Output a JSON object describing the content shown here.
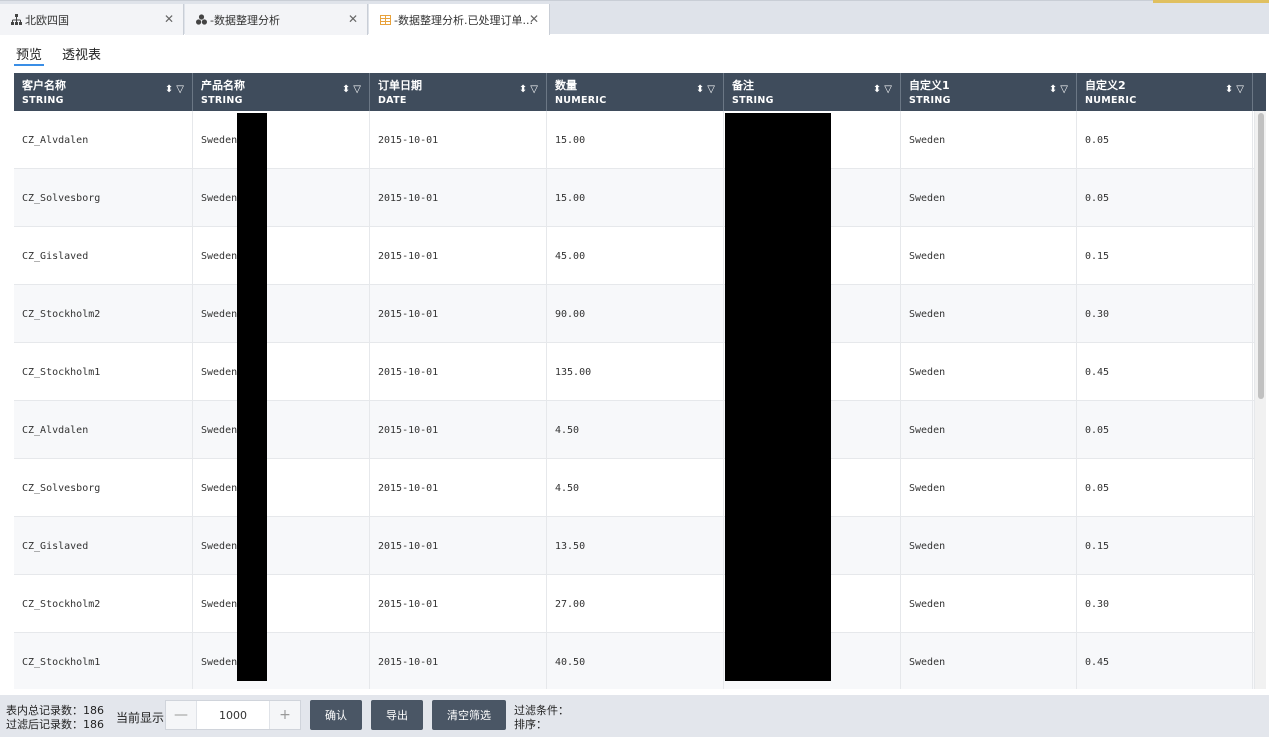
{
  "tabs": [
    {
      "icon": "hierarchy-icon",
      "label": "北欧四国"
    },
    {
      "icon": "cluster-icon",
      "label": "-数据整理分析"
    },
    {
      "icon": "table-icon",
      "label": "-数据整理分析.已处理订单..."
    }
  ],
  "subtabs": [
    {
      "label": "预览"
    },
    {
      "label": "透视表"
    }
  ],
  "columns": [
    {
      "name": "客户名称",
      "type": "STRING"
    },
    {
      "name": "产品名称",
      "type": "STRING"
    },
    {
      "name": "订单日期",
      "type": "DATE"
    },
    {
      "name": "数量",
      "type": "NUMERIC"
    },
    {
      "name": "备注",
      "type": "STRING"
    },
    {
      "name": "自定义1",
      "type": "STRING"
    },
    {
      "name": "自定义2",
      "type": "NUMERIC"
    }
  ],
  "rows": [
    [
      "CZ_Alvdalen",
      "Sweden_",
      "2015-10-01",
      "15.00",
      "",
      "Sweden",
      "0.05"
    ],
    [
      "CZ_Solvesborg",
      "Sweden_",
      "2015-10-01",
      "15.00",
      "",
      "Sweden",
      "0.05"
    ],
    [
      "CZ_Gislaved",
      "Sweden_",
      "2015-10-01",
      "45.00",
      "",
      "Sweden",
      "0.15"
    ],
    [
      "CZ_Stockholm2",
      "Sweden_",
      "2015-10-01",
      "90.00",
      "",
      "Sweden",
      "0.30"
    ],
    [
      "CZ_Stockholm1",
      "Sweden_",
      "2015-10-01",
      "135.00",
      "",
      "Sweden",
      "0.45"
    ],
    [
      "CZ_Alvdalen",
      "Sweden_",
      "2015-10-01",
      "4.50",
      "",
      "Sweden",
      "0.05"
    ],
    [
      "CZ_Solvesborg",
      "Sweden_",
      "2015-10-01",
      "4.50",
      "",
      "Sweden",
      "0.05"
    ],
    [
      "CZ_Gislaved",
      "Sweden_",
      "2015-10-01",
      "13.50",
      "",
      "Sweden",
      "0.15"
    ],
    [
      "CZ_Stockholm2",
      "Sweden_",
      "2015-10-01",
      "27.00",
      "",
      "Sweden",
      "0.30"
    ],
    [
      "CZ_Stockholm1",
      "Sweden_",
      "2015-10-01",
      "40.50",
      "",
      "Sweden",
      "0.45"
    ]
  ],
  "footer": {
    "total_records": "表内总记录数：186",
    "filtered_records": "过滤后记录数：186",
    "show_label": "当前显示",
    "stepper_value": "1000",
    "minus": "—",
    "plus": "+",
    "confirm": "确认",
    "export": "导出",
    "clear_filter": "清空筛选",
    "filter_condition": "过滤条件：",
    "sort": "排序："
  },
  "colors": {
    "header_bg": "#3f4c5c",
    "button_bg": "#4a5665",
    "active_underline": "#3a8ee6",
    "tab_icon_orange": "#e8a23c"
  }
}
